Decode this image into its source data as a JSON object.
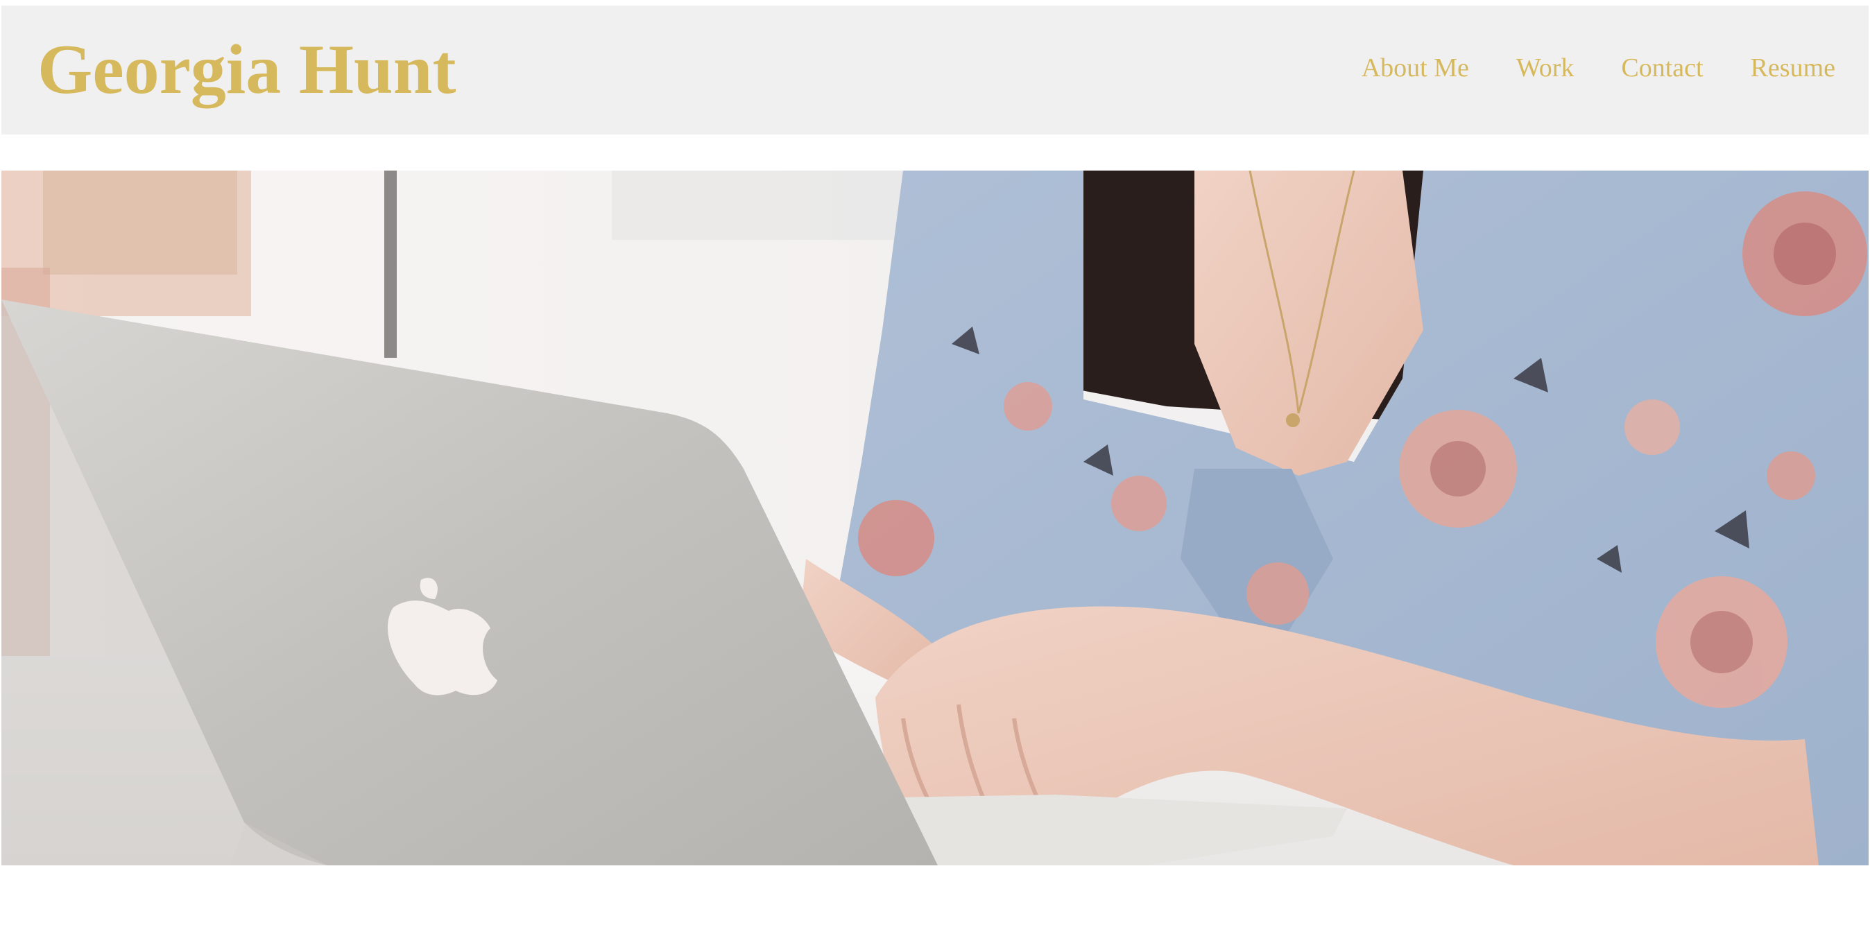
{
  "header": {
    "site_title": "Georgia Hunt",
    "accent_color": "#d6b95c",
    "background_color": "#f1f0f0"
  },
  "nav": {
    "items": [
      {
        "label": "About Me"
      },
      {
        "label": "Work"
      },
      {
        "label": "Contact"
      },
      {
        "label": "Resume"
      }
    ]
  },
  "hero": {
    "image_subject": "person typing on silver laptop in floral blouse",
    "icons": [
      "apple-logo-icon"
    ]
  }
}
